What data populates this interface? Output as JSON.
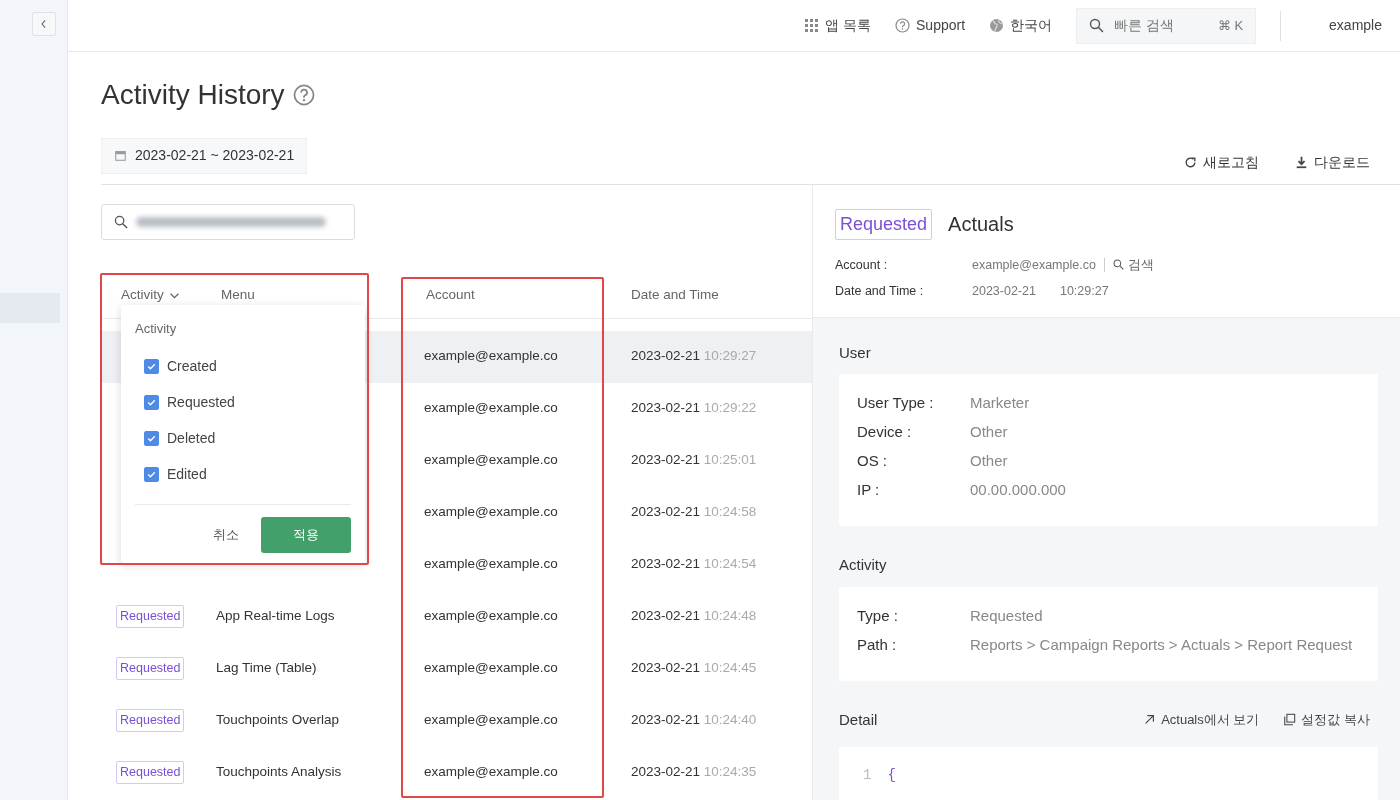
{
  "topbar": {
    "items": [
      {
        "kind": "apps",
        "label": "앱 목록"
      },
      {
        "kind": "help",
        "label": "Support"
      },
      {
        "kind": "globe",
        "label": "한국어"
      }
    ],
    "search": {
      "placeholder": "빠른 검색",
      "shortcut": "⌘ K"
    },
    "user": "example"
  },
  "page": {
    "title": "Activity History",
    "date_range": "2023-02-21 ~ 2023-02-21",
    "actions": [
      {
        "kind": "refresh",
        "label": "새로고침"
      },
      {
        "kind": "download",
        "label": "다운로드"
      }
    ]
  },
  "table": {
    "columns": [
      {
        "label": "Activity",
        "filter": true,
        "highlighted": false
      },
      {
        "label": "Menu",
        "filter": false,
        "highlighted": false
      },
      {
        "label": "Account",
        "filter": false,
        "highlighted": true
      },
      {
        "label": "Date and Time",
        "filter": false,
        "highlighted": false
      }
    ],
    "rows": [
      {
        "account": "example@example.co",
        "date": "2023-02-21",
        "time": "10:29:27",
        "selected": true
      },
      {
        "account": "example@example.co",
        "date": "2023-02-21",
        "time": "10:29:22",
        "selected": false
      },
      {
        "account": "example@example.co",
        "date": "2023-02-21",
        "time": "10:25:01",
        "selected": false
      },
      {
        "account": "example@example.co",
        "date": "2023-02-21",
        "time": "10:24:58",
        "selected": false
      },
      {
        "account": "example@example.co",
        "date": "2023-02-21",
        "time": "10:24:54",
        "selected": false
      },
      {
        "activity": "Requested",
        "menu": "App Real-time Logs",
        "account": "example@example.co",
        "date": "2023-02-21",
        "time": "10:24:48",
        "selected": false
      },
      {
        "activity": "Requested",
        "menu": "Lag Time (Table)",
        "account": "example@example.co",
        "date": "2023-02-21",
        "time": "10:24:45",
        "selected": false
      },
      {
        "activity": "Requested",
        "menu": "Touchpoints Overlap",
        "account": "example@example.co",
        "date": "2023-02-21",
        "time": "10:24:40",
        "selected": false
      },
      {
        "activity": "Requested",
        "menu": "Touchpoints Analysis",
        "account": "example@example.co",
        "date": "2023-02-21",
        "time": "10:24:35",
        "selected": false
      }
    ],
    "filter_dropdown": {
      "open": true,
      "highlighted": true,
      "title": "Activity",
      "options": [
        {
          "label": "Created",
          "checked": true
        },
        {
          "label": "Requested",
          "checked": true
        },
        {
          "label": "Deleted",
          "checked": true
        },
        {
          "label": "Edited",
          "checked": true
        }
      ],
      "cancel": "취소",
      "apply": "적용"
    }
  },
  "detail": {
    "badge": "Requested",
    "title": "Actuals",
    "meta": [
      {
        "label": "Account :",
        "values": [
          "example@example.co"
        ],
        "search": "검색"
      },
      {
        "label": "Date and Time :",
        "values": [
          "2023-02-21",
          "10:29:27"
        ]
      }
    ],
    "sections": [
      {
        "title": "User",
        "fields": [
          {
            "label": "User Type :",
            "value": "Marketer"
          },
          {
            "label": "Device :",
            "value": "Other"
          },
          {
            "label": "OS :",
            "value": "Other"
          },
          {
            "label": "IP :",
            "value": "00.00.000.000"
          }
        ]
      },
      {
        "title": "Activity",
        "fields": [
          {
            "label": "Type :",
            "value": "Requested"
          },
          {
            "label": "Path :",
            "value": "Reports > Campaign Reports > Actuals > Report Request"
          }
        ]
      }
    ],
    "code_section": {
      "title": "Detail",
      "actions": [
        {
          "kind": "external",
          "label": "Actuals에서 보기"
        },
        {
          "kind": "copy",
          "label": "설정값 복사"
        }
      ],
      "lines": [
        {
          "number": "1",
          "text": "{"
        }
      ]
    }
  }
}
